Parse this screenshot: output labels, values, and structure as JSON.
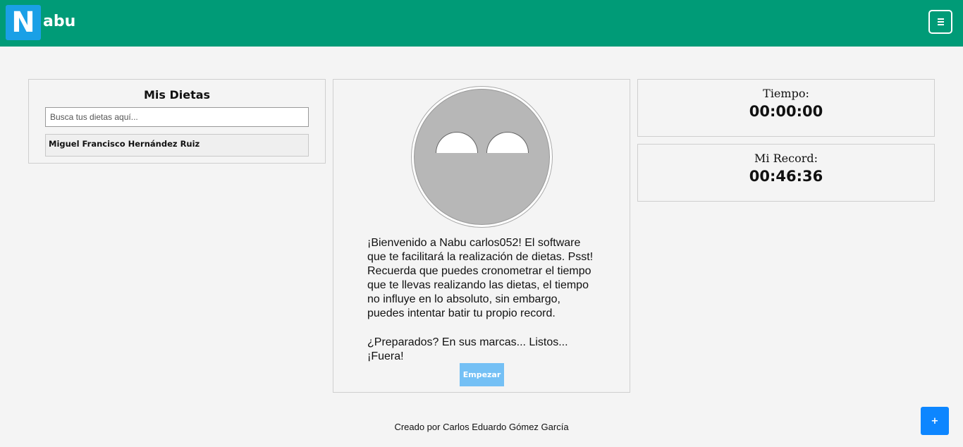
{
  "header": {
    "logo_letter": "N",
    "logo_text": "abu",
    "menu_icon": "hamburger-menu-icon",
    "colors": {
      "navbar": "#009b77",
      "logo_box": "#1aa0e6"
    }
  },
  "dietas": {
    "title": "Mis Dietas",
    "search_placeholder": "Busca tus dietas aquí...",
    "items": [
      {
        "label": "Miguel Francisco Hernández Ruiz"
      }
    ]
  },
  "main": {
    "avatar_icon": "smiley-face-icon",
    "welcome_text": "¡Bienvenido a Nabu carlos052! El software que te facilitará la realización de dietas. Psst! Recuerda que puedes cronometrar el tiempo que te llevas realizando las dietas, el tiempo no influye en lo absoluto, sin embargo, puedes intentar batir tu propio record.",
    "ready_text": "¿Preparados? En sus marcas... Listos... ¡Fuera!",
    "start_label": "Empezar"
  },
  "stats": {
    "tiempo_label": "Tiempo:",
    "tiempo_value": "00:00:00",
    "record_label": "Mi Record:",
    "record_value": "00:46:36"
  },
  "footer": {
    "credit": "Creado por Carlos Eduardo Gómez García",
    "fab_label": "+"
  }
}
